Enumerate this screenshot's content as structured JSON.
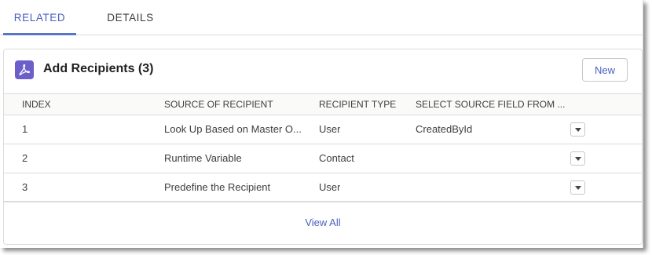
{
  "tabs": [
    {
      "label": "RELATED",
      "active": true
    },
    {
      "label": "DETAILS",
      "active": false
    }
  ],
  "card": {
    "title": "Add Recipients (3)",
    "icon": "pdf-icon",
    "icon_color": "#6b5fc9",
    "new_label": "New"
  },
  "table": {
    "headers": [
      "INDEX",
      "SOURCE OF RECIPIENT",
      "RECIPIENT TYPE",
      "SELECT SOURCE FIELD FROM ..."
    ],
    "rows": [
      {
        "index": "1",
        "source": "Look Up Based on Master O...",
        "type": "User",
        "field": "CreatedById"
      },
      {
        "index": "2",
        "source": "Runtime Variable",
        "type": "Contact",
        "field": ""
      },
      {
        "index": "3",
        "source": "Predefine the Recipient",
        "type": "User",
        "field": ""
      }
    ]
  },
  "footer": {
    "view_all": "View All"
  },
  "colors": {
    "accent": "#4a5fc1",
    "tab_underline": "#5a74c9"
  }
}
